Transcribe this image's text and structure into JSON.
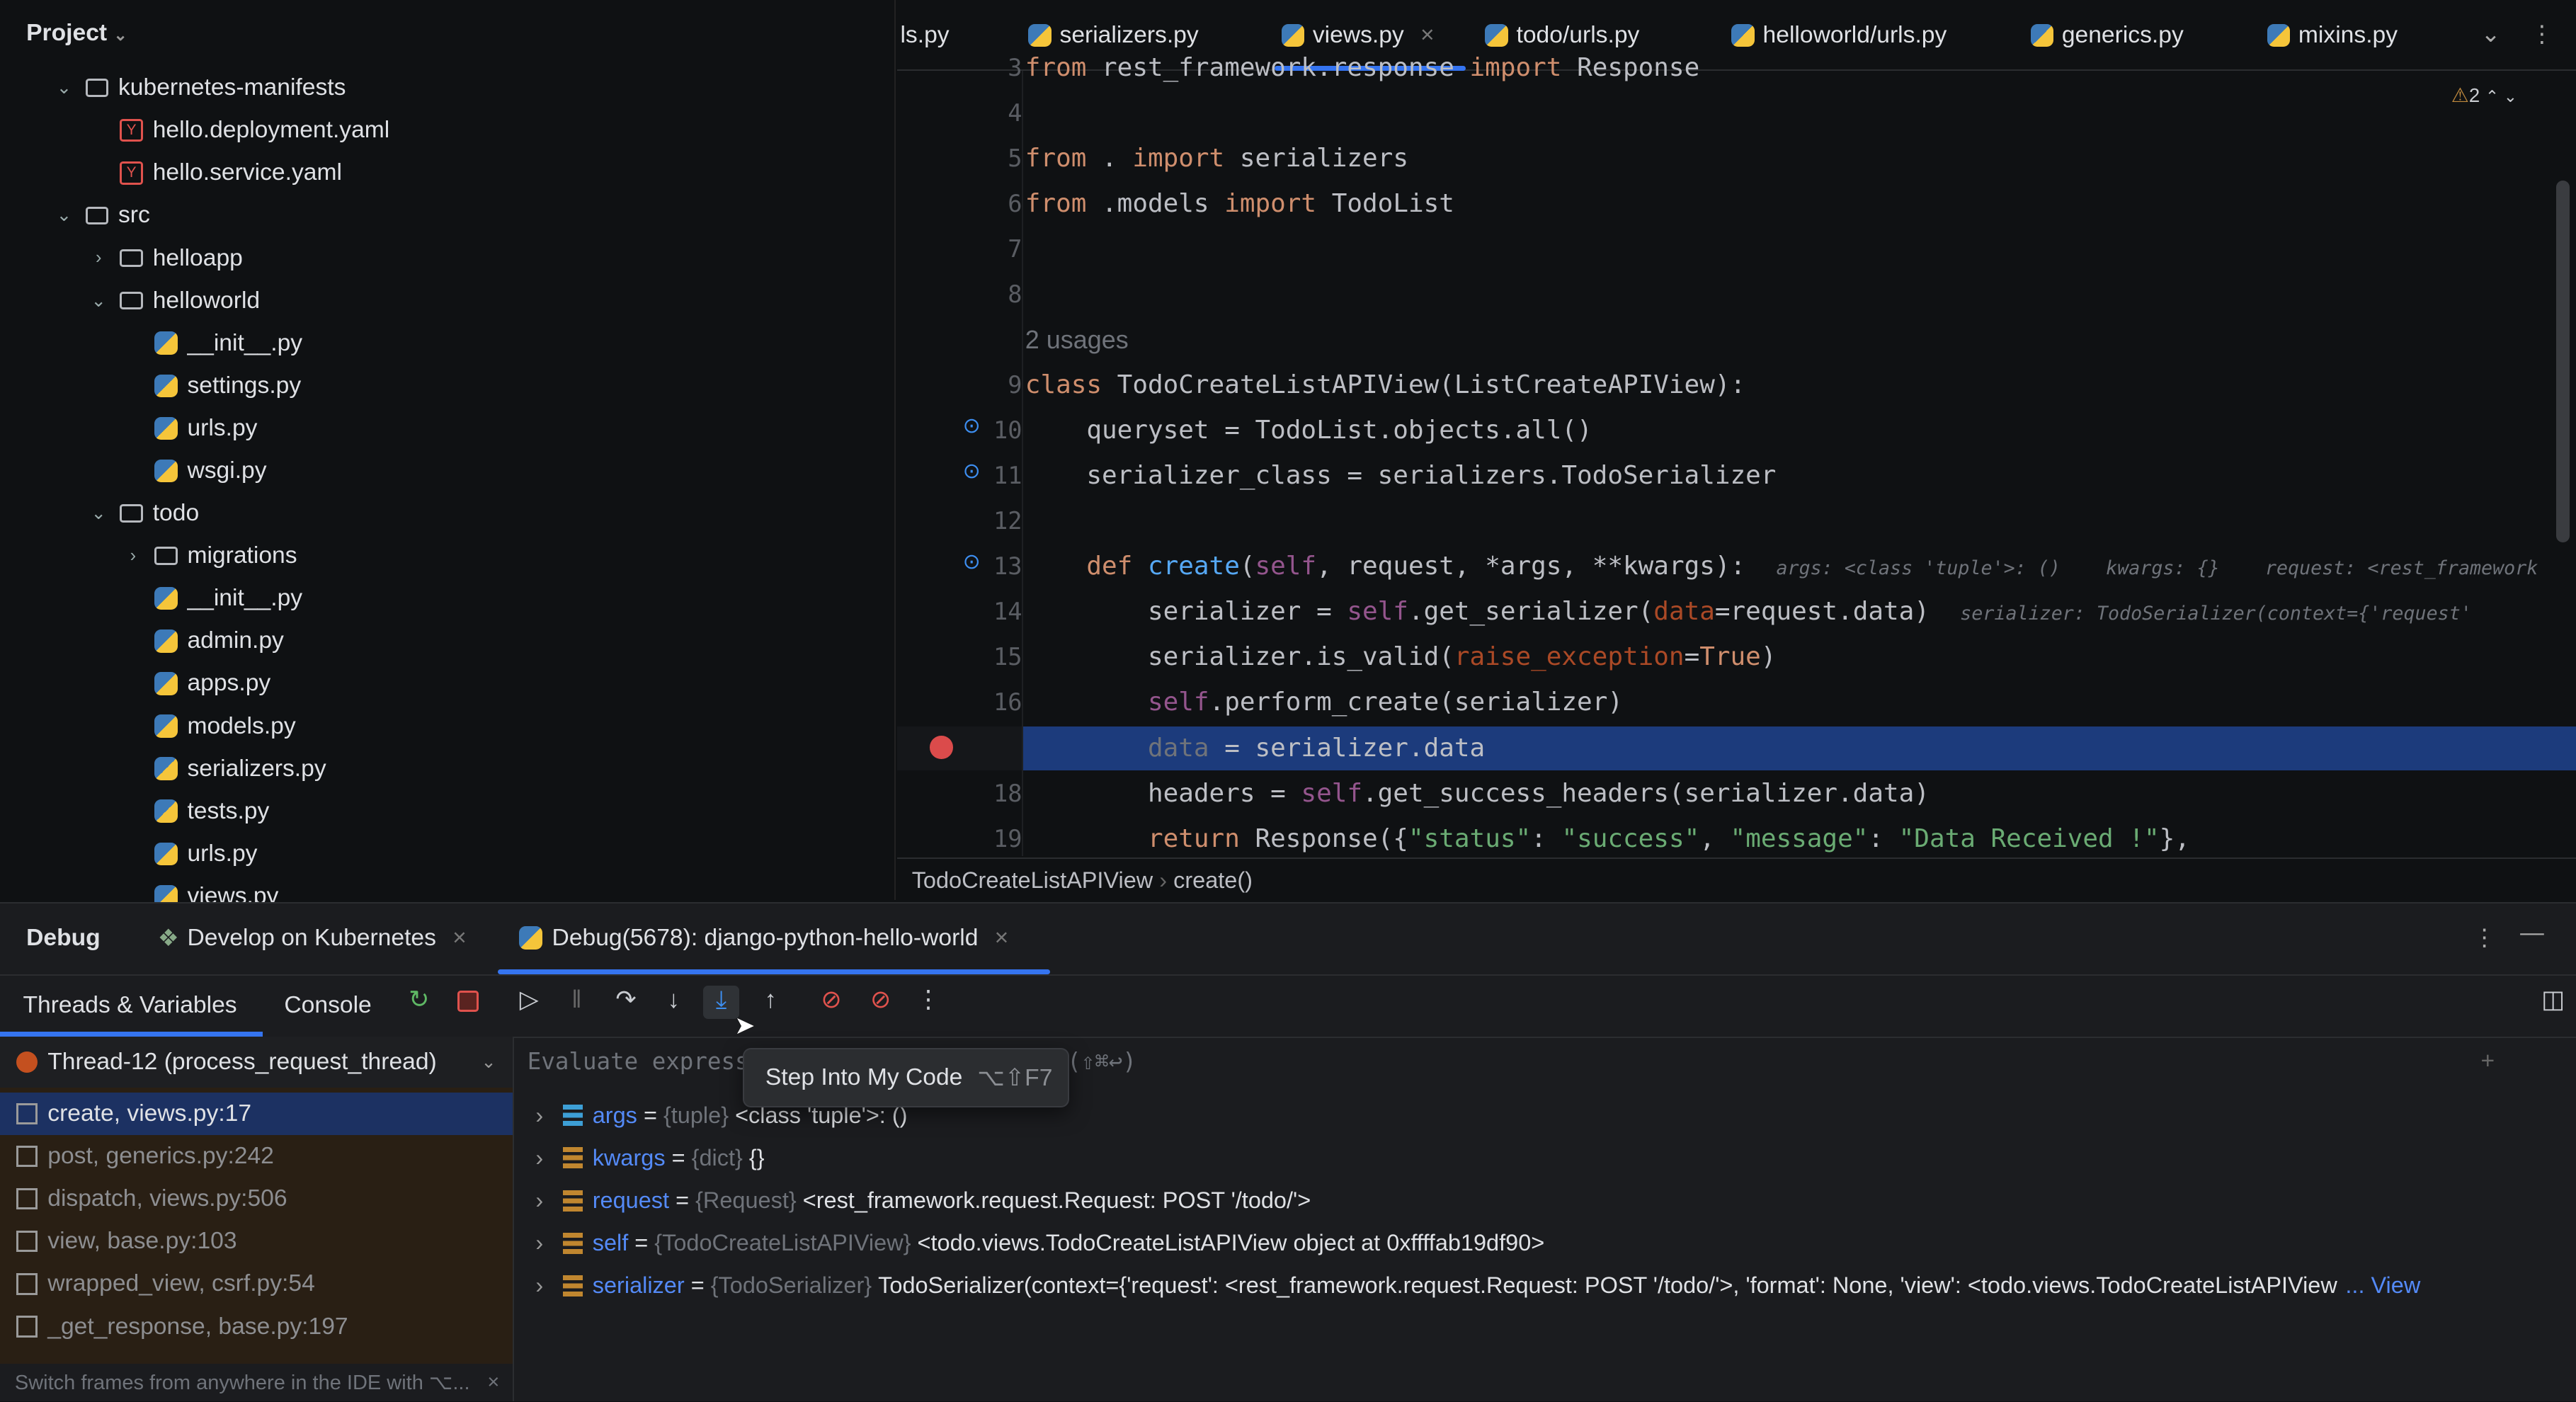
{
  "project": {
    "title": "Project",
    "tree": [
      {
        "label": "kubernetes-manifests",
        "depth": 1,
        "type": "folder",
        "expanded": true
      },
      {
        "label": "hello.deployment.yaml",
        "depth": 2,
        "type": "yaml"
      },
      {
        "label": "hello.service.yaml",
        "depth": 2,
        "type": "yaml"
      },
      {
        "label": "src",
        "depth": 1,
        "type": "folder",
        "expanded": true
      },
      {
        "label": "helloapp",
        "depth": 2,
        "type": "folder",
        "expanded": false
      },
      {
        "label": "helloworld",
        "depth": 2,
        "type": "folder",
        "expanded": true
      },
      {
        "label": "__init__.py",
        "depth": 3,
        "type": "py"
      },
      {
        "label": "settings.py",
        "depth": 3,
        "type": "py"
      },
      {
        "label": "urls.py",
        "depth": 3,
        "type": "py"
      },
      {
        "label": "wsgi.py",
        "depth": 3,
        "type": "py"
      },
      {
        "label": "todo",
        "depth": 2,
        "type": "folder",
        "expanded": true
      },
      {
        "label": "migrations",
        "depth": 3,
        "type": "folder",
        "expanded": false
      },
      {
        "label": "__init__.py",
        "depth": 3,
        "type": "py"
      },
      {
        "label": "admin.py",
        "depth": 3,
        "type": "py"
      },
      {
        "label": "apps.py",
        "depth": 3,
        "type": "py"
      },
      {
        "label": "models.py",
        "depth": 3,
        "type": "py"
      },
      {
        "label": "serializers.py",
        "depth": 3,
        "type": "py"
      },
      {
        "label": "tests.py",
        "depth": 3,
        "type": "py"
      },
      {
        "label": "urls.py",
        "depth": 3,
        "type": "py"
      },
      {
        "label": "views.py",
        "depth": 3,
        "type": "py"
      }
    ]
  },
  "editor_tabs": [
    {
      "label": "ls.py",
      "icon": false
    },
    {
      "label": "serializers.py"
    },
    {
      "label": "views.py",
      "active": true,
      "closable": true
    },
    {
      "label": "todo/urls.py"
    },
    {
      "label": "helloworld/urls.py"
    },
    {
      "label": "generics.py"
    },
    {
      "label": "mixins.py"
    }
  ],
  "warnings": {
    "count": "2"
  },
  "code": [
    {
      "n": "3",
      "t": [
        [
          "from ",
          "k"
        ],
        [
          "rest_framework.response ",
          ""
        ],
        [
          "import ",
          "k"
        ],
        [
          "Response",
          ""
        ]
      ]
    },
    {
      "n": "4",
      "t": []
    },
    {
      "n": "5",
      "t": [
        [
          "from ",
          "k"
        ],
        [
          ". ",
          ""
        ],
        [
          "import ",
          "k"
        ],
        [
          "serializers",
          ""
        ]
      ]
    },
    {
      "n": "6",
      "t": [
        [
          "from ",
          "k"
        ],
        [
          ".models ",
          ""
        ],
        [
          "import ",
          "k"
        ],
        [
          "TodoList",
          ""
        ]
      ]
    },
    {
      "n": "7",
      "t": []
    },
    {
      "n": "8",
      "t": []
    },
    {
      "n": "",
      "t": [
        [
          "2 usages",
          "dim"
        ]
      ],
      "lens": true
    },
    {
      "n": "9",
      "t": [
        [
          "class ",
          "k"
        ],
        [
          "TodoCreateListAPIView(ListCreateAPIView):",
          ""
        ]
      ]
    },
    {
      "n": "10",
      "t": [
        [
          "    queryset = TodoList.objects.all()",
          ""
        ]
      ],
      "mark": true
    },
    {
      "n": "11",
      "t": [
        [
          "    serializer_class = serializers.TodoSerializer",
          ""
        ]
      ],
      "mark": true
    },
    {
      "n": "12",
      "t": []
    },
    {
      "n": "13",
      "t": [
        [
          "    def ",
          "k"
        ],
        [
          "create",
          "f"
        ],
        [
          "(",
          ""
        ],
        [
          "self",
          "self"
        ],
        [
          ", request, *args, **kwargs):  ",
          ""
        ],
        [
          "args: <class 'tuple'>: ()    kwargs: {}    request: <rest_framework",
          "hint"
        ]
      ],
      "mark": true
    },
    {
      "n": "14",
      "t": [
        [
          "        serializer = ",
          ""
        ],
        [
          "self",
          "self"
        ],
        [
          ".get_serializer(",
          ""
        ],
        [
          "data",
          "p"
        ],
        [
          "=request.data)  ",
          ""
        ],
        [
          "serializer: TodoSerializer(context={'request'",
          "hint"
        ]
      ]
    },
    {
      "n": "15",
      "t": [
        [
          "        serializer.is_valid(",
          ""
        ],
        [
          "raise_exception",
          "p"
        ],
        [
          "=",
          ""
        ],
        [
          "True",
          "k"
        ],
        [
          ")",
          ""
        ]
      ]
    },
    {
      "n": "16",
      "t": [
        [
          "        ",
          ""
        ],
        [
          "self",
          "self"
        ],
        [
          ".perform_create(serializer)",
          ""
        ]
      ]
    },
    {
      "n": "17",
      "t": [
        [
          "        ",
          ""
        ],
        [
          "data",
          "dim"
        ],
        [
          " = serializer.data",
          ""
        ]
      ],
      "current": true,
      "breakpoint": true
    },
    {
      "n": "18",
      "t": [
        [
          "        headers = ",
          ""
        ],
        [
          "self",
          "self"
        ],
        [
          ".get_success_headers(serializer.data)",
          ""
        ]
      ]
    },
    {
      "n": "19",
      "t": [
        [
          "        ",
          ""
        ],
        [
          "return ",
          "k"
        ],
        [
          "Response({",
          ""
        ],
        [
          "\"status\"",
          "s"
        ],
        [
          ": ",
          ""
        ],
        [
          "\"success\"",
          "s"
        ],
        [
          ", ",
          ""
        ],
        [
          "\"message\"",
          "s"
        ],
        [
          ": ",
          ""
        ],
        [
          "\"Data Received !\"",
          "s"
        ],
        [
          "},",
          ""
        ]
      ]
    }
  ],
  "breadcrumb": [
    "TodoCreateListAPIView",
    "create()"
  ],
  "debug": {
    "title": "Debug",
    "tabs": [
      {
        "label": "Develop on Kubernetes"
      },
      {
        "label": "Debug(5678): django-python-hello-world",
        "active": true
      }
    ],
    "subtabs": {
      "threads": "Threads & Variables",
      "console": "Console"
    },
    "thread": "Thread-12 (process_request_thread)",
    "frames": [
      "create, views.py:17",
      "post, generics.py:242",
      "dispatch, views.py:506",
      "view, base.py:103",
      "wrapped_view, csrf.py:54",
      "_get_response, base.py:197"
    ],
    "frames_hint": "Switch frames from anywhere in the IDE with ⌥...",
    "evaluate_placeholder": "Evaluate expression (↩) or add a watch (⇧⌘↩)",
    "tooltip": {
      "label": "Step Into My Code",
      "shortcut": "⌥⇧F7"
    },
    "variables": [
      {
        "name": "args",
        "type": "{tuple}",
        "value": "<class 'tuple'>: ()",
        "icon": "list"
      },
      {
        "name": "kwargs",
        "type": "{dict}",
        "value": "{}"
      },
      {
        "name": "request",
        "type": "{Request}",
        "value": "<rest_framework.request.Request: POST '/todo/'>"
      },
      {
        "name": "self",
        "type": "{TodoCreateListAPIView}",
        "value": "<todo.views.TodoCreateListAPIView object at 0xffffab19df90>"
      },
      {
        "name": "serializer",
        "type": "{TodoSerializer}",
        "value": "TodoSerializer(context={'request': <rest_framework.request.Request: POST '/todo/'>, 'format': None, 'view': <todo.views.TodoCreateListAPIView",
        "more": "... View"
      }
    ]
  }
}
